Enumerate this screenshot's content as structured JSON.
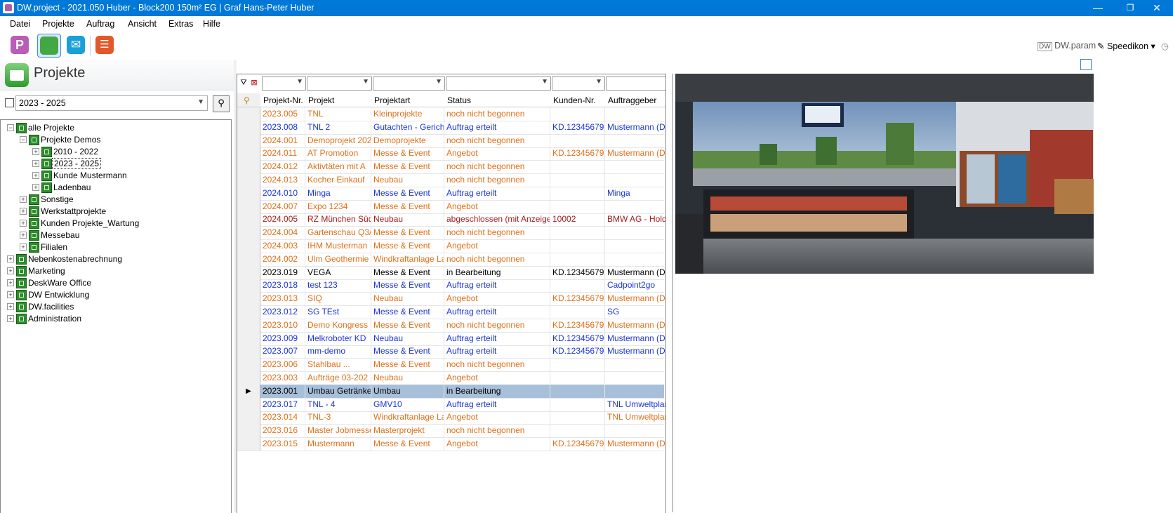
{
  "window": {
    "title": "DW.project - 2021.050 Huber - Block200 150m² EG | Graf Hans-Peter Huber",
    "minimize": "—",
    "maximize": "❐",
    "close": "✕"
  },
  "menu": [
    "Datei",
    "Projekte",
    "Auftrag",
    "Ansicht",
    "Extras",
    "Hilfe"
  ],
  "toolbar": {
    "buttons": [
      {
        "icon": "p-icon",
        "glyph": "P",
        "color": "#b85db8"
      },
      {
        "icon": "folder-icon",
        "glyph": "",
        "color": "#43a843"
      },
      {
        "icon": "mail-icon",
        "glyph": "✉",
        "color": "#1aa0d8"
      },
      {
        "icon": "list-icon",
        "glyph": "☰",
        "color": "#e2582b"
      }
    ],
    "right": {
      "param": "DW.param",
      "speedikon": "Speedikon ▾"
    }
  },
  "left": {
    "title": "Projekte",
    "year_filter": "2023 - 2025",
    "tree": [
      {
        "label": "alle Projekte",
        "level": 0,
        "exp": "−"
      },
      {
        "label": "Projekte Demos",
        "level": 1,
        "exp": "−"
      },
      {
        "label": "2010 - 2022",
        "level": 2,
        "exp": "+"
      },
      {
        "label": "2023 - 2025",
        "level": 2,
        "exp": "+",
        "selected": true
      },
      {
        "label": "Kunde Mustermann",
        "level": 2,
        "exp": "+"
      },
      {
        "label": "Ladenbau",
        "level": 2,
        "exp": "+"
      },
      {
        "label": "Sonstige",
        "level": 1,
        "exp": "+"
      },
      {
        "label": "Werkstattprojekte",
        "level": 1,
        "exp": "+"
      },
      {
        "label": "Kunden Projekte_Wartung",
        "level": 1,
        "exp": "+"
      },
      {
        "label": "Messebau",
        "level": 1,
        "exp": "+"
      },
      {
        "label": "Filialen",
        "level": 1,
        "exp": "+"
      },
      {
        "label": "Nebenkostenabrechnung",
        "level": 0,
        "exp": "+"
      },
      {
        "label": "Marketing",
        "level": 0,
        "exp": "+"
      },
      {
        "label": "DeskWare Office",
        "level": 0,
        "exp": "+"
      },
      {
        "label": "DW Entwicklung",
        "level": 0,
        "exp": "+"
      },
      {
        "label": "DW.facilities",
        "level": 0,
        "exp": "+"
      },
      {
        "label": "Administration",
        "level": 0,
        "exp": "+"
      }
    ]
  },
  "grid": {
    "columns": [
      "Projekt-Nr.",
      "Projekt",
      "Projektart",
      "Status",
      "Kunden-Nr.",
      "Auftraggeber"
    ],
    "rows": [
      {
        "c": "orange",
        "v": [
          "2023.005",
          "TNL",
          "Kleinprojekte",
          "noch nicht begonnen",
          "",
          ""
        ]
      },
      {
        "c": "blue",
        "v": [
          "2023.008",
          "TNL 2",
          "Gutachten - Gerich",
          "Auftrag erteilt",
          "KD.12345679",
          "Mustermann (De"
        ]
      },
      {
        "c": "orange",
        "v": [
          "2024.001",
          "Demoprojekt 202",
          "Demoprojekte",
          "noch nicht begonnen",
          "",
          ""
        ]
      },
      {
        "c": "orange",
        "v": [
          "2024.011",
          "AT Promotion",
          "Messe & Event",
          "Angebot",
          "KD.12345679",
          "Mustermann (De"
        ]
      },
      {
        "c": "orange",
        "v": [
          "2024.012",
          "Aktivtäten mit A",
          "Messe & Event",
          "noch nicht begonnen",
          "",
          ""
        ]
      },
      {
        "c": "orange",
        "v": [
          "2024.013",
          "Kocher Einkauf",
          "Neubau",
          "noch nicht begonnen",
          "",
          ""
        ]
      },
      {
        "c": "blue",
        "v": [
          "2024.010",
          "Minga",
          "Messe & Event",
          "Auftrag erteilt",
          "",
          "Minga"
        ]
      },
      {
        "c": "orange",
        "v": [
          "2024.007",
          "Expo 1234",
          "Messe & Event",
          "Angebot",
          "",
          ""
        ]
      },
      {
        "c": "red",
        "v": [
          "2024.005",
          "RZ München Süd",
          "Neubau",
          "abgeschlossen (mit Anzeige)",
          "10002",
          "BMW AG - Hold"
        ]
      },
      {
        "c": "orange",
        "v": [
          "2024.004",
          "Gartenschau Q3/",
          "Messe & Event",
          "noch nicht begonnen",
          "",
          ""
        ]
      },
      {
        "c": "orange",
        "v": [
          "2024.003",
          "IHM Musterman",
          "Messe & Event",
          "Angebot",
          "",
          ""
        ]
      },
      {
        "c": "orange",
        "v": [
          "2024.002",
          "Ulm Geothermie",
          "Windkraftanlage La",
          "noch nicht begonnen",
          "",
          ""
        ]
      },
      {
        "c": "black",
        "v": [
          "2023.019",
          "VEGA",
          "Messe & Event",
          "in Bearbeitung",
          "KD.12345679",
          "Mustermann (De"
        ]
      },
      {
        "c": "blue",
        "v": [
          "2023.018",
          "test 123",
          "Messe & Event",
          "Auftrag erteilt",
          "",
          "Cadpoint2go"
        ]
      },
      {
        "c": "orange",
        "v": [
          "2023.013",
          "SIQ",
          "Neubau",
          "Angebot",
          "KD.12345679",
          "Mustermann (De"
        ]
      },
      {
        "c": "blue",
        "v": [
          "2023.012",
          "SG TEst",
          "Messe & Event",
          "Auftrag erteilt",
          "",
          "SG"
        ]
      },
      {
        "c": "orange",
        "v": [
          "2023.010",
          "Demo Kongress",
          "Messe & Event",
          "noch nicht begonnen",
          "KD.12345679",
          "Mustermann (De"
        ]
      },
      {
        "c": "blue",
        "v": [
          "2023.009",
          "Melkroboter KD",
          "Neubau",
          "Auftrag erteilt",
          "KD.12345679",
          "Mustermann (De"
        ]
      },
      {
        "c": "blue",
        "v": [
          "2023.007",
          "mm-demo",
          "Messe & Event",
          "Auftrag erteilt",
          "KD.12345679",
          "Mustermann (De"
        ]
      },
      {
        "c": "orange",
        "v": [
          "2023.006",
          "Stahlbau ...",
          "Messe & Event",
          "noch nicht begonnen",
          "",
          ""
        ]
      },
      {
        "c": "orange",
        "v": [
          "2023.003",
          "Aufträge 03-202",
          "Neubau",
          "Angebot",
          "",
          ""
        ]
      },
      {
        "c": "black",
        "v": [
          "2023.001",
          "Umbau Getränke",
          "Umbau",
          "in Bearbeitung",
          "",
          ""
        ],
        "selected": true
      },
      {
        "c": "blue",
        "v": [
          "2023.017",
          "TNL - 4",
          "GMV10",
          "Auftrag erteilt",
          "",
          "TNL Umweltplan"
        ]
      },
      {
        "c": "orange",
        "v": [
          "2023.014",
          "TNL-3",
          "Windkraftanlage La",
          "Angebot",
          "",
          "TNL Umweltplan"
        ]
      },
      {
        "c": "orange",
        "v": [
          "2023.016",
          "Master Jobmesse",
          "Masterprojekt",
          "noch nicht begonnen",
          "",
          ""
        ]
      },
      {
        "c": "orange",
        "v": [
          "2023.015",
          "Mustermann",
          "Messe & Event",
          "Angebot",
          "KD.12345679",
          "Mustermann (De"
        ]
      }
    ]
  },
  "colors": {
    "orange": "#e0701b",
    "blue": "#1c36d6",
    "black": "#000000",
    "red": "#a41e1e",
    "titlebar": "#0078d7",
    "selrow": "#a7bfd9"
  }
}
